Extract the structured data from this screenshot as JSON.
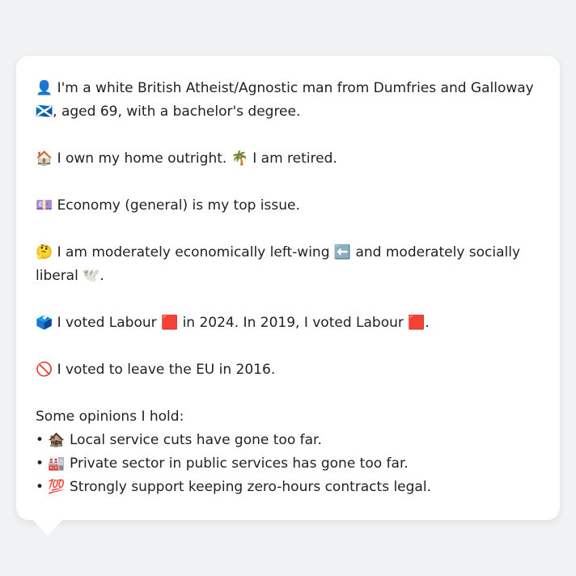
{
  "card": {
    "p1": "👤 I'm a white British Atheist/Agnostic man from Dumfries and Galloway 🏴󠁧󠁢󠁳󠁣󠁴󠁿, aged 69, with a bachelor's degree.",
    "p2": "🏠 I own my home outright. 🌴 I am retired.",
    "p3": "💷 Economy (general) is my top issue.",
    "p4": "🤔 I am moderately economically left-wing ⬅️ and moderately socially liberal 🕊️.",
    "p5": "🗳️ I voted Labour 🟥 in 2024. In 2019, I voted Labour 🟥.",
    "p6": "🚫 I voted to leave the EU in 2016.",
    "opinions_heading": "Some opinions I hold:",
    "opinions": [
      "• 🏚️ Local service cuts have gone too far.",
      "• 🏭 Private sector in public services has gone too far.",
      "• 💯 Strongly support keeping zero-hours contracts legal."
    ]
  }
}
